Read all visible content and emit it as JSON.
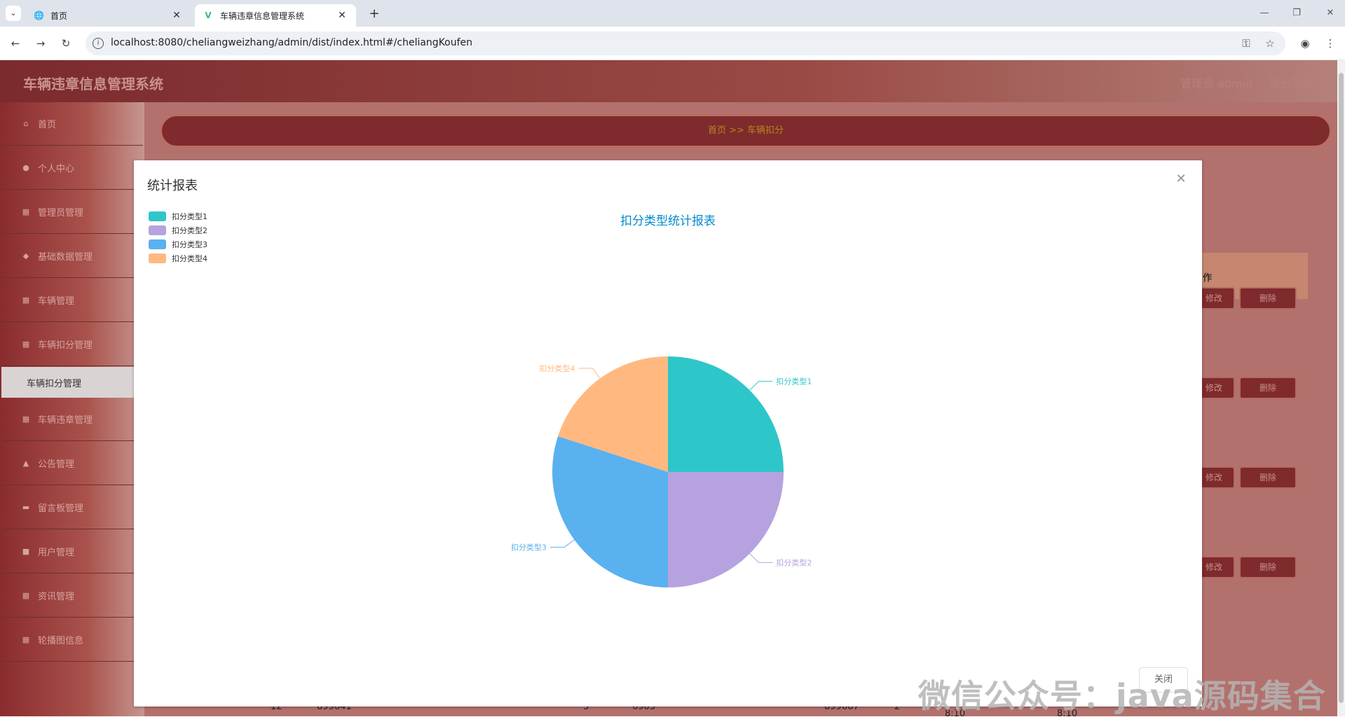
{
  "browser": {
    "tabs": [
      {
        "title": "首页",
        "icon": "globe-icon"
      },
      {
        "title": "车辆违章信息管理系统",
        "icon": "vue-icon"
      }
    ],
    "url": "localhost:8080/cheliangweizhang/admin/dist/index.html#/cheliangKoufen"
  },
  "app": {
    "title": "车辆违章信息管理系统",
    "user_label": "管理员 admin",
    "logout_label": "退出登录"
  },
  "sidebar": {
    "items": [
      {
        "label": "首页",
        "icon": "home-icon"
      },
      {
        "label": "个人中心",
        "icon": "user-icon"
      },
      {
        "label": "管理员管理",
        "icon": "grid-icon"
      },
      {
        "label": "基础数据管理",
        "icon": "pin-icon"
      },
      {
        "label": "车辆管理",
        "icon": "grid-icon"
      },
      {
        "label": "车辆扣分管理",
        "icon": "grid-icon"
      },
      {
        "label": "车辆违章管理",
        "icon": "grid-icon"
      },
      {
        "label": "公告管理",
        "icon": "chart-icon"
      },
      {
        "label": "留言板管理",
        "icon": "message-icon"
      },
      {
        "label": "用户管理",
        "icon": "lock-icon"
      },
      {
        "label": "资讯管理",
        "icon": "grid-icon"
      },
      {
        "label": "轮播图信息",
        "icon": "grid-icon"
      }
    ],
    "sub_item": "车辆扣分管理"
  },
  "main": {
    "breadcrumb": "首页 >> 车辆扣分",
    "op_header": "作",
    "edit_label": "修改",
    "delete_label": "删除",
    "footer_cells": [
      "12",
      "899641",
      "3",
      "6903",
      "899667",
      "2",
      "8:10",
      "8:10"
    ]
  },
  "modal": {
    "title": "统计报表",
    "close_label": "关闭"
  },
  "chart_data": {
    "type": "pie",
    "title": "扣分类型统计报表",
    "legend_position": "top-left",
    "series": [
      {
        "name": "扣分类型1",
        "value": 1,
        "color": "#2ec7c9"
      },
      {
        "name": "扣分类型2",
        "value": 1,
        "color": "#b6a2de"
      },
      {
        "name": "扣分类型3",
        "value": 1.2,
        "color": "#5ab1ef"
      },
      {
        "name": "扣分类型4",
        "value": 0.8,
        "color": "#ffb980"
      }
    ]
  },
  "watermark": "微信公众号：java源码集合"
}
